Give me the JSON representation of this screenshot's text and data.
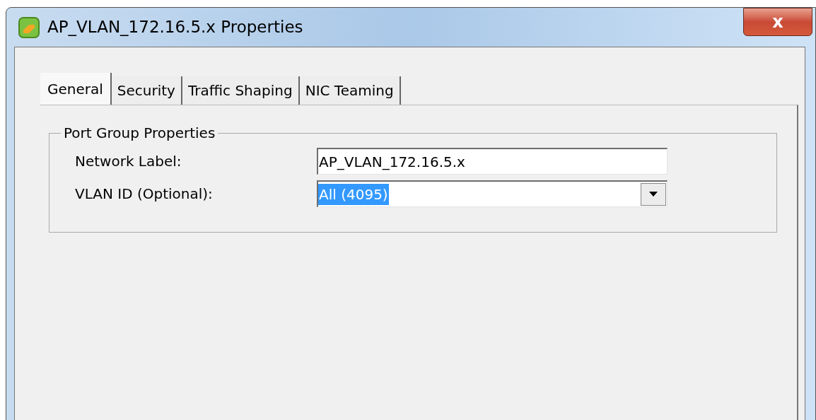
{
  "window": {
    "title": "AP_VLAN_172.16.5.x Properties",
    "close": "x"
  },
  "tabs": [
    {
      "label": "General",
      "selected": true
    },
    {
      "label": "Security",
      "selected": false
    },
    {
      "label": "Traffic Shaping",
      "selected": false
    },
    {
      "label": "NIC Teaming",
      "selected": false
    }
  ],
  "group": {
    "title": "Port Group Properties",
    "fields": [
      {
        "kind": "text",
        "label": "Network Label:",
        "value": "AP_VLAN_172.16.5.x",
        "selected": false
      },
      {
        "kind": "dropdown",
        "label": "VLAN ID (Optional):",
        "value": "All (4095)",
        "selected": true
      }
    ]
  }
}
